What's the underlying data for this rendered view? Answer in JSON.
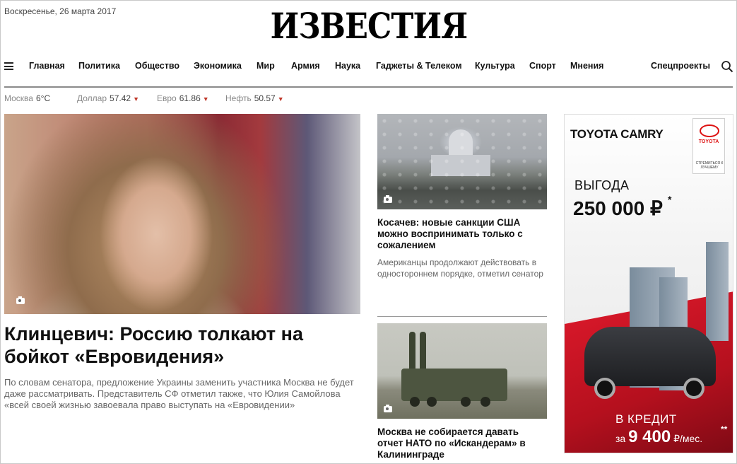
{
  "header": {
    "date": "Воскресенье, 26 марта 2017",
    "logo": "ИЗВЕСТИЯ"
  },
  "nav": {
    "items": [
      "Главная",
      "Политика",
      "Общество",
      "Экономика",
      "Мир",
      "Армия",
      "Наука",
      "Гаджеты & Телеком",
      "Культура",
      "Спорт",
      "Мнения"
    ],
    "special": "Спецпроекты",
    "icons": {
      "menu": "hamburger-icon",
      "search": "search-icon"
    }
  },
  "ticker": [
    {
      "label": "Москва",
      "value": "6°C",
      "dropdown": false
    },
    {
      "label": "Доллар",
      "value": "57.42",
      "dropdown": true
    },
    {
      "label": "Евро",
      "value": "61.86",
      "dropdown": true
    },
    {
      "label": "Нефть",
      "value": "50.57",
      "dropdown": true
    }
  ],
  "lead": {
    "title": "Клинцевич: Россию толкают на бойкот «Евровидения»",
    "text": "По словам сенатора, предложение Украины заменить участника Москва не будет даже рассматривать. Представитель СФ отметил также, что Юлия Самойлова «всей своей жизнью завоевала право выступать на «Евровидении»"
  },
  "side_articles": [
    {
      "title": "Косачев: новые санкции США можно воспринимать только с сожалением",
      "text": "Американцы продолжают действовать в одностороннем порядке, отметил сенатор"
    },
    {
      "title": "Москва не собирается давать отчет НАТО по «Искандерам» в Калининграде"
    }
  ],
  "ad": {
    "brand": "TOYOTA CAMRY",
    "logo_brand": "TOYOTA",
    "logo_slogan": "СТРЕМИТЬСЯ К ЛУЧШЕМУ",
    "label1": "ВЫГОДА",
    "amount": "250 000 ₽",
    "star1": "*",
    "label2": "В КРЕДИТ",
    "price_prefix": "за",
    "price": "9 400",
    "price_suffix": "₽/мес.",
    "star2": "**"
  },
  "colors": {
    "accent": "#c0392b",
    "ad_red": "#e01a2c"
  }
}
